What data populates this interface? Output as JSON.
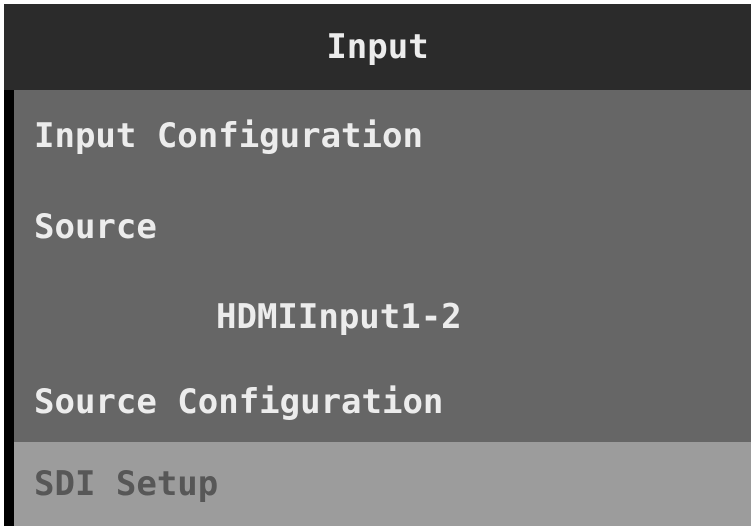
{
  "window": {
    "title": "Input"
  },
  "menu": {
    "items": [
      {
        "label": "Input Configuration",
        "kind": "header"
      },
      {
        "label": "Source",
        "kind": "header"
      },
      {
        "label": "HDMIInput1-2",
        "kind": "value"
      },
      {
        "label": "Source Configuration",
        "kind": "header"
      },
      {
        "label": "SDI Setup",
        "kind": "item",
        "selected": true
      }
    ]
  },
  "colors": {
    "title_bar": "#2b2b2b",
    "menu_background": "#666666",
    "selected_background": "#9c9c9c",
    "text": "#ececec",
    "selected_text": "#575757"
  }
}
